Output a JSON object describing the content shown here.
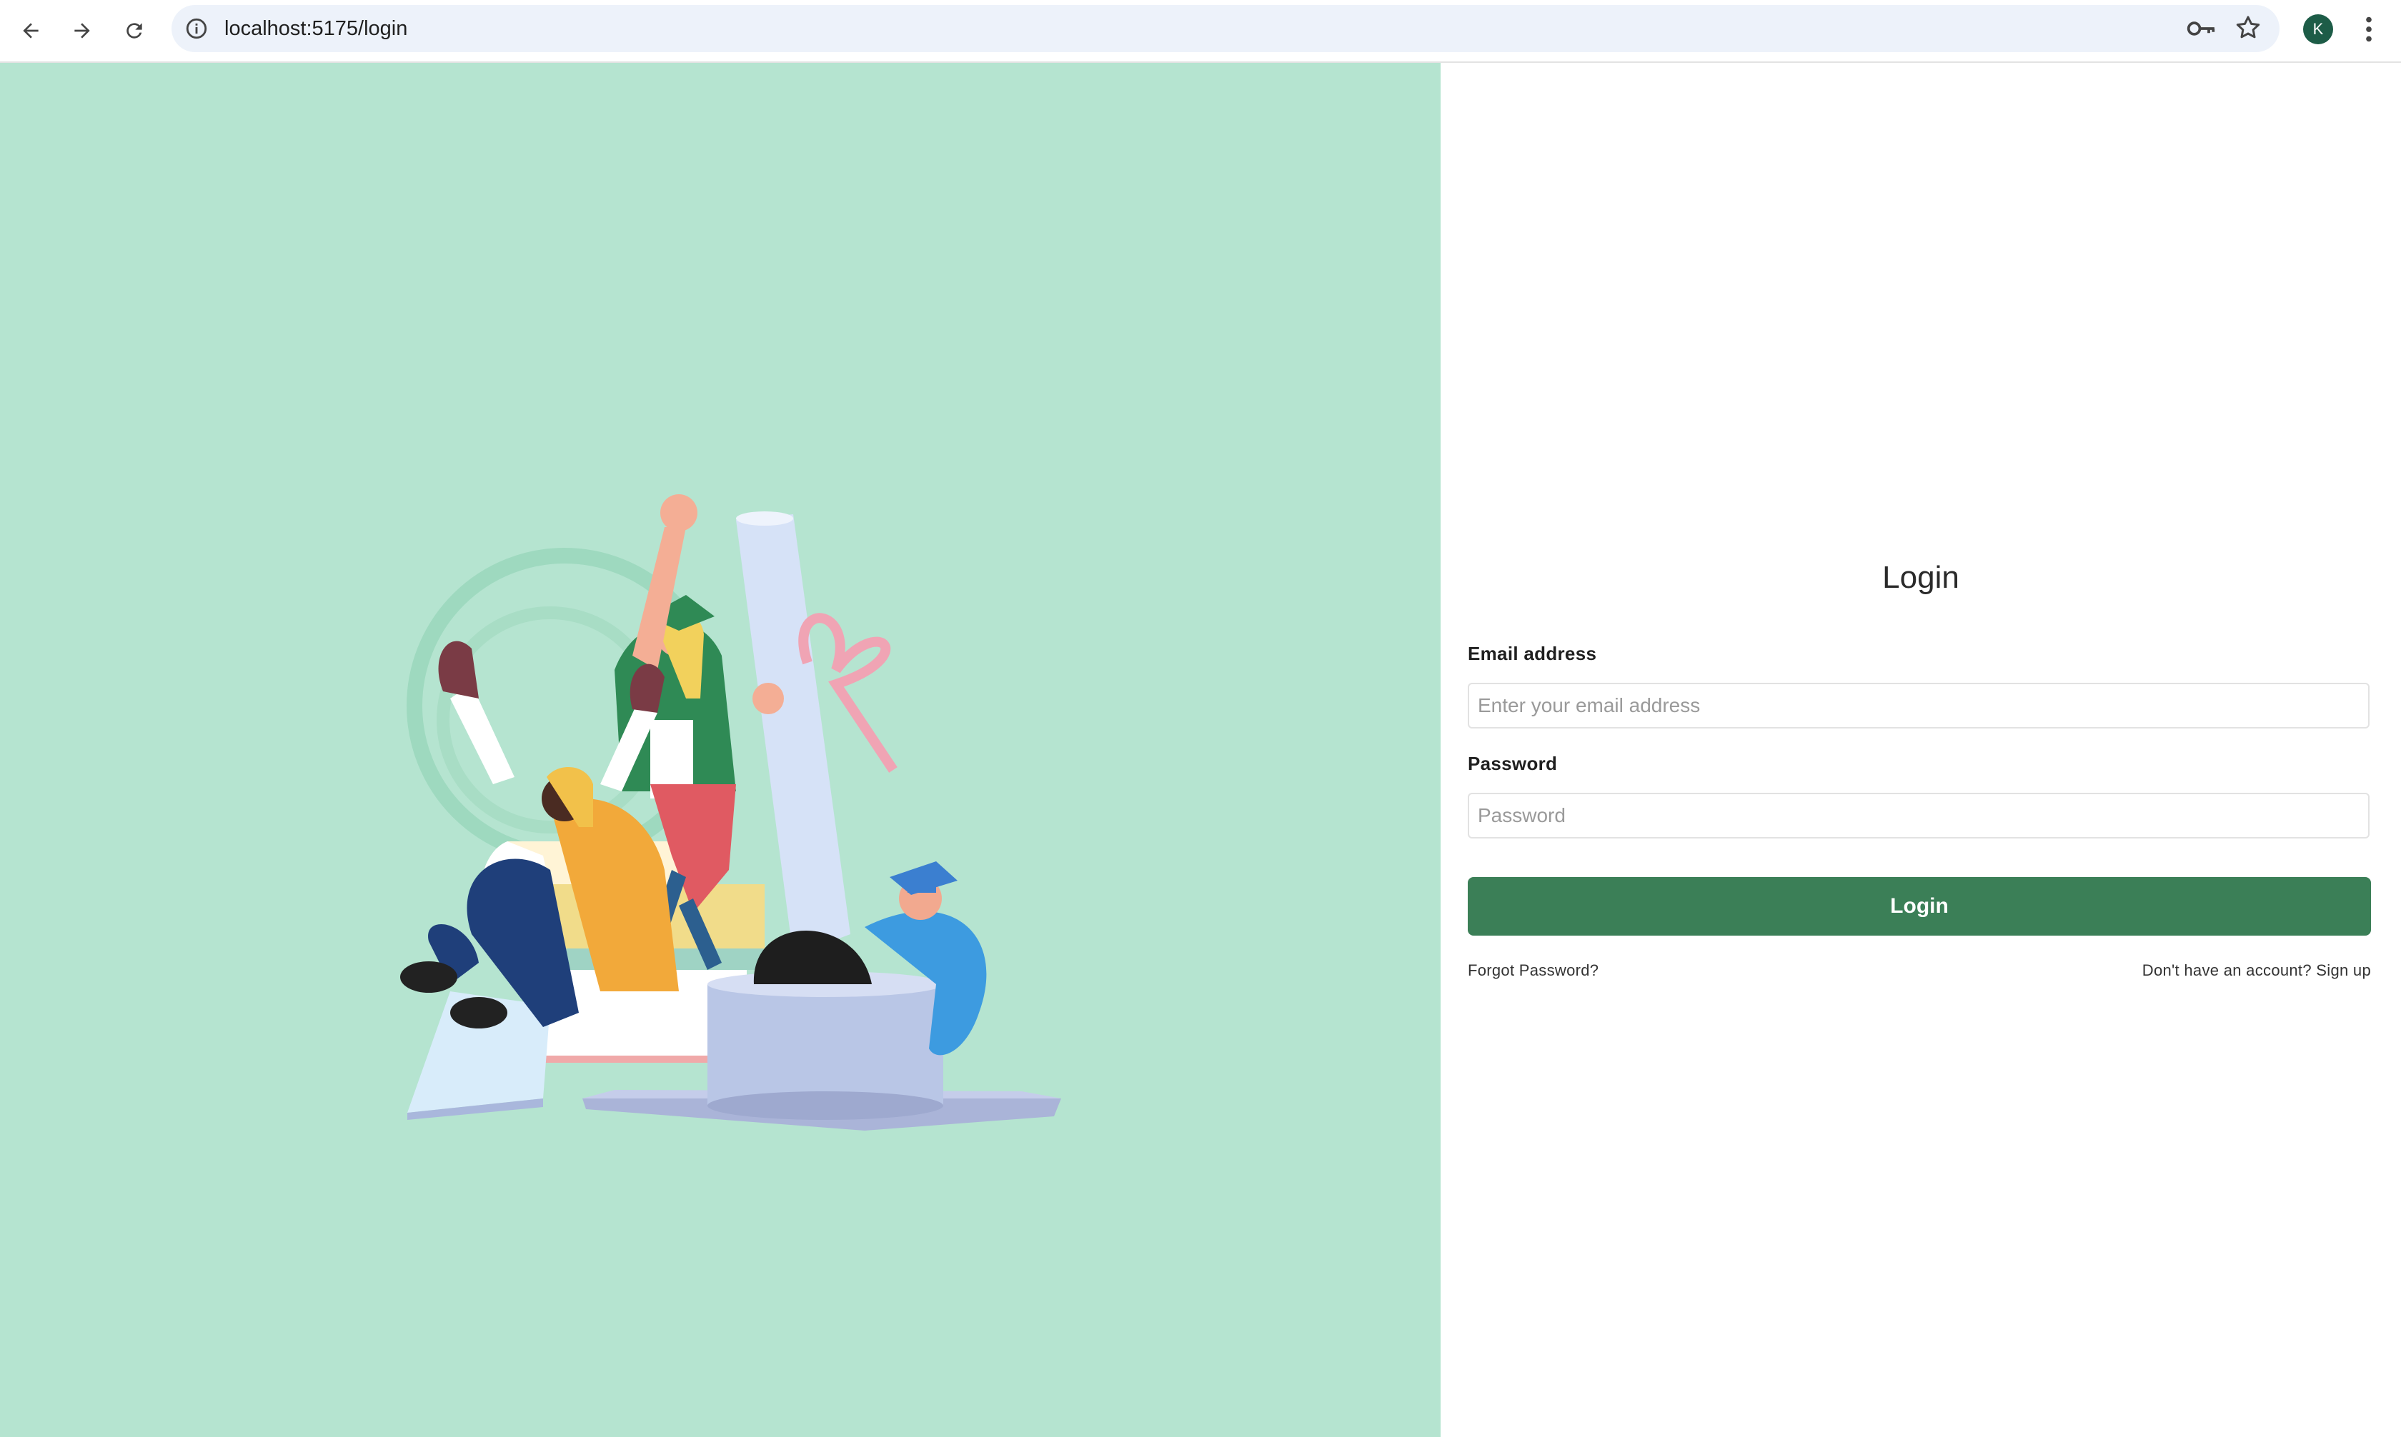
{
  "browser": {
    "url": "localhost:5175/login",
    "profile_initial": "K",
    "profile_color": "#1d5c47"
  },
  "icons": {
    "back": "back-arrow-icon",
    "forward": "forward-arrow-icon",
    "reload": "reload-icon",
    "site_info": "info-icon",
    "password_manager": "key-icon",
    "bookmark": "star-icon",
    "menu": "kebab-menu-icon"
  },
  "colors": {
    "left_panel_bg": "#b5e4d0",
    "accent": "#3b7f57"
  },
  "login": {
    "title": "Login",
    "email_label": "Email address",
    "email_placeholder": "Enter your email address",
    "email_value": "",
    "password_label": "Password",
    "password_placeholder": "Password",
    "password_value": "",
    "submit_label": "Login",
    "forgot_link": "Forgot Password?",
    "signup_link": "Don't have an account? Sign up"
  }
}
